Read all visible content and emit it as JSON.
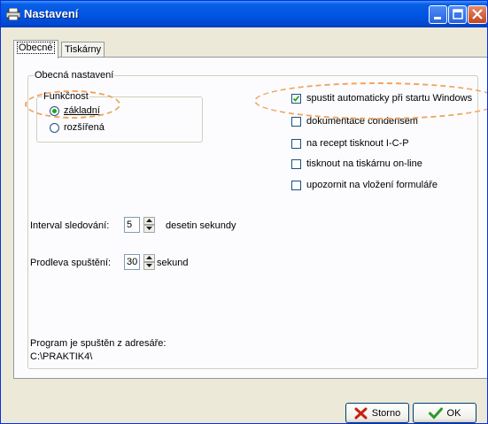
{
  "window": {
    "title": "Nastavení"
  },
  "tabs": [
    {
      "label": "Obecné",
      "active": true
    },
    {
      "label": "Tiskárny",
      "active": false
    }
  ],
  "general_group": {
    "label": "Obecná nastavení"
  },
  "functionality": {
    "label": "Funkčnost",
    "options": [
      {
        "label": "základní",
        "checked": true
      },
      {
        "label": "rozšířená",
        "checked": false
      }
    ]
  },
  "checkboxes": [
    {
      "label": "spustit automaticky při startu Windows",
      "checked": true
    },
    {
      "label": "dokumentace condensem",
      "checked": false
    },
    {
      "label": "na recept tisknout I-C-P",
      "checked": false
    },
    {
      "label": "tisknout na tiskárnu on-line",
      "checked": false
    },
    {
      "label": "upozornit na vložení formuláře",
      "checked": false
    }
  ],
  "interval": {
    "label": "Interval sledování:",
    "value": "5",
    "unit": "desetin sekundy"
  },
  "delay": {
    "label": "Prodleva spuštění:",
    "value": "30",
    "unit": "sekund"
  },
  "program_path": {
    "label": "Program je spuštěn z adresáře:",
    "value": "C:\\PRAKTIK4\\"
  },
  "buttons": {
    "cancel": "Storno",
    "ok": "OK"
  },
  "icons": {
    "title": "printer-icon",
    "cancel": "red-x-icon",
    "ok": "green-check-icon"
  }
}
